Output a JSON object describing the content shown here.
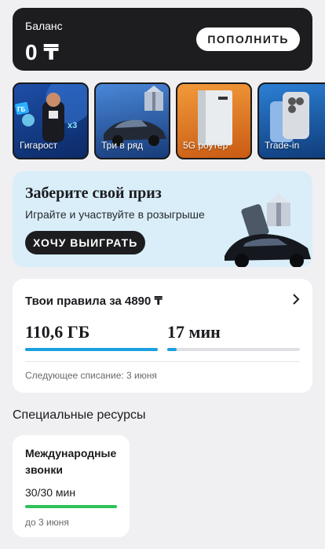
{
  "balance": {
    "label": "Баланс",
    "amount": "0 ₸",
    "topup_label": "ПОПОЛНИТЬ"
  },
  "stories": [
    {
      "label": "Гигарост"
    },
    {
      "label": "Три в ряд"
    },
    {
      "label": "5G роутер"
    },
    {
      "label": "Trade-in"
    }
  ],
  "story_texts": {
    "badge_1": "ГБ",
    "badge_2": "x3"
  },
  "promo": {
    "title": "Заберите свой приз",
    "subtitle": "Играйте и участвуйте в розыгрыше",
    "button_label": "ХОЧУ ВЫИГРАТЬ"
  },
  "tariff": {
    "title": "Твои правила за 4890 ₸",
    "data_value": "110,6 ГБ",
    "data_fraction": 1.0,
    "minutes_value": "17 мин",
    "minutes_fraction": 0.07,
    "next_charge": "Следующее списание: 3 июня"
  },
  "special": {
    "heading": "Специальные ресурсы",
    "card_title": "Международные звонки",
    "amount": "30/30 мин",
    "fraction": 1.0,
    "until": "до 3 июня"
  },
  "colors": {
    "accent_blue": "#1b9fe0",
    "accent_green": "#2ec158",
    "dark": "#1d1d20",
    "promo_bg": "#d9eef9"
  }
}
